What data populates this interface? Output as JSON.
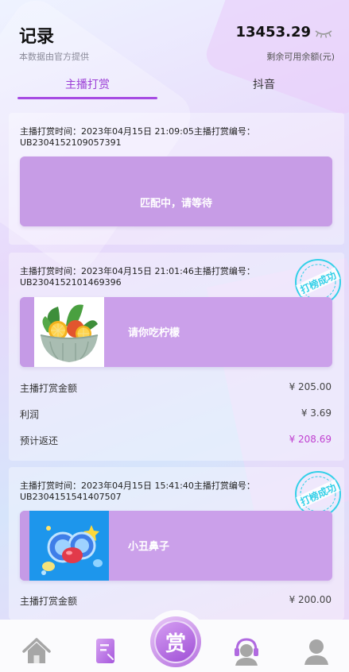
{
  "header": {
    "title": "记录",
    "subtitle": "本数据由官方提供",
    "balance": "13453.29",
    "balance_label": "剩余可用余额(元)"
  },
  "tabs": [
    {
      "label": "主播打赏",
      "active": true
    },
    {
      "label": "抖音",
      "active": false
    }
  ],
  "records": [
    {
      "line1": "主播打赏时间：2023年04月15日 21:09:05主播打赏编号：",
      "line2": "UB2304152109057391",
      "status_text": "匹配中，请等待"
    },
    {
      "line1": "主播打赏时间：2023年04月15日 21:01:46主播打赏编号：",
      "line2": "UB2304152101469396",
      "stamp": "打榜成功",
      "gift_name": "请你吃柠檬",
      "gift_icon": "lemon-bowl-icon",
      "rows": [
        {
          "label": "主播打赏金额",
          "value": "¥ 205.00"
        },
        {
          "label": "利润",
          "value": "¥ 3.69"
        },
        {
          "label": "预计返还",
          "value": "¥ 208.69",
          "highlight": true
        }
      ]
    },
    {
      "line1": "主播打赏时间：2023年04月15日 15:41:40主播打赏编号：",
      "line2": "UB2304151541407507",
      "stamp": "打榜成功",
      "gift_name": "小丑鼻子",
      "gift_icon": "clown-nose-icon",
      "rows": [
        {
          "label": "主播打赏金额",
          "value": "¥ 200.00"
        }
      ]
    }
  ],
  "tabbar": {
    "center_label": "赏",
    "items": [
      "home-icon",
      "records-icon",
      "reward-icon",
      "service-icon",
      "profile-icon"
    ]
  },
  "colors": {
    "accent": "#a64be3",
    "card_box": "#c79ce6",
    "highlight_value": "#c040d0",
    "stamp": "#33d0e8",
    "nav_gray": "#a6a6a6"
  }
}
